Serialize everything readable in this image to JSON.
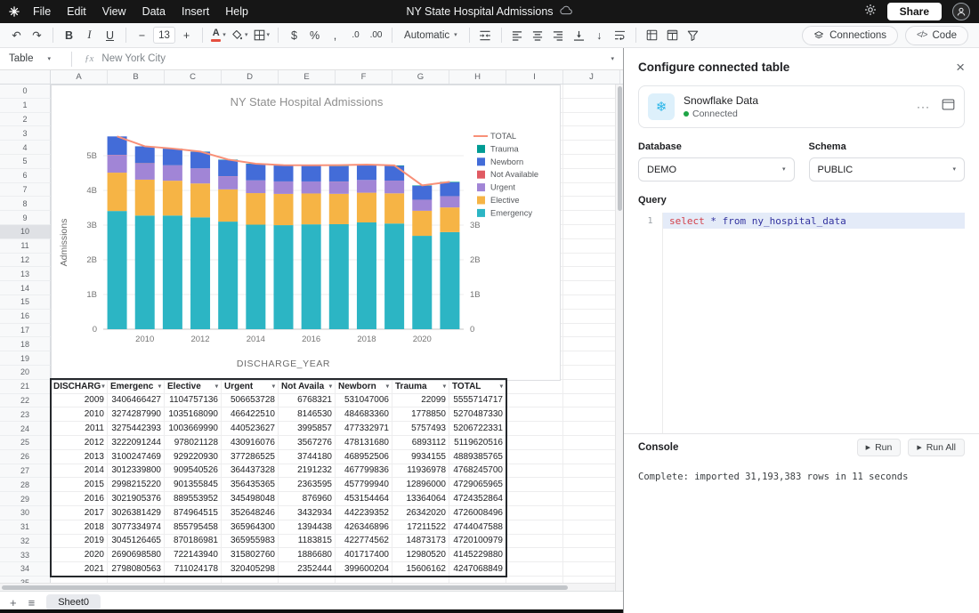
{
  "topbar": {
    "menus": [
      "File",
      "Edit",
      "View",
      "Data",
      "Insert",
      "Help"
    ],
    "title": "NY State Hospital Admissions",
    "share_label": "Share"
  },
  "toolbar": {
    "font_size": "13",
    "format_mode": "Automatic",
    "connections_label": "Connections",
    "code_label": "Code",
    "code_glyph": "</>"
  },
  "formula_bar": {
    "range_label": "Table",
    "value": "New York City"
  },
  "icons": {
    "undo": "↶",
    "redo": "↷",
    "bold": "B",
    "italic": "I",
    "underline": "U",
    "minus": "−",
    "plus": "+",
    "dollar": "$",
    "percent": "%",
    "comma": ",",
    "dec_dec": ".0",
    "dec_inc": ".00",
    "chevron": "▾",
    "fx": "ƒx",
    "close": "×",
    "dots": "···",
    "snowflake": "❄",
    "run": "▶",
    "add": "+",
    "list": "≡",
    "text_color": "A",
    "arrow_down": "↓"
  },
  "grid": {
    "columns": [
      "A",
      "B",
      "C",
      "D",
      "E",
      "F",
      "G",
      "H",
      "I",
      "J"
    ],
    "row_start": 0,
    "row_end": 35,
    "selected_row": 10
  },
  "table": {
    "origin": {
      "row": 21,
      "col": 0
    },
    "headers": [
      "DISCHARG",
      "Emergenc",
      "Elective",
      "Urgent",
      "Not Availa",
      "Newborn",
      "Trauma",
      "TOTAL"
    ],
    "rows": [
      [
        "2009",
        "3406466427",
        "1104757136",
        "506653728",
        "6768321",
        "531047006",
        "22099",
        "5555714717"
      ],
      [
        "2010",
        "3274287990",
        "1035168090",
        "466422510",
        "8146530",
        "484683360",
        "1778850",
        "5270487330"
      ],
      [
        "2011",
        "3275442393",
        "1003669990",
        "440523627",
        "3995857",
        "477332971",
        "5757493",
        "5206722331"
      ],
      [
        "2012",
        "3222091244",
        "978021128",
        "430916076",
        "3567276",
        "478131680",
        "6893112",
        "5119620516"
      ],
      [
        "2013",
        "3100247469",
        "929220930",
        "377286525",
        "3744180",
        "468952506",
        "9934155",
        "4889385765"
      ],
      [
        "2014",
        "3012339800",
        "909540526",
        "364437328",
        "2191232",
        "467799836",
        "11936978",
        "4768245700"
      ],
      [
        "2015",
        "2998215220",
        "901355845",
        "356435365",
        "2363595",
        "457799940",
        "12896000",
        "4729065965"
      ],
      [
        "2016",
        "3021905376",
        "889553952",
        "345498048",
        "876960",
        "453154464",
        "13364064",
        "4724352864"
      ],
      [
        "2017",
        "3026381429",
        "874964515",
        "352648246",
        "3432934",
        "442239352",
        "26342020",
        "4726008496"
      ],
      [
        "2018",
        "3077334974",
        "855795458",
        "365964300",
        "1394438",
        "426346896",
        "17211522",
        "4744047588"
      ],
      [
        "2019",
        "3045126465",
        "870186981",
        "365955983",
        "1183815",
        "422774562",
        "14873173",
        "4720100979"
      ],
      [
        "2020",
        "2690698580",
        "722143940",
        "315802760",
        "1886680",
        "401717400",
        "12980520",
        "4145229880"
      ],
      [
        "2021",
        "2798080563",
        "711024178",
        "320405298",
        "2352444",
        "399600204",
        "15606162",
        "4247068849"
      ]
    ]
  },
  "chart_data": {
    "type": "stacked_bar_with_line",
    "title": "NY State Hospital Admissions",
    "xlabel": "DISCHARGE_YEAR",
    "ylabel": "Admissions",
    "x": [
      2009,
      2010,
      2011,
      2012,
      2013,
      2014,
      2015,
      2016,
      2017,
      2018,
      2019,
      2020,
      2021
    ],
    "series": [
      {
        "name": "Emergency",
        "color": "#2cb5c4",
        "values": [
          3406466427,
          3274287990,
          3275442393,
          3222091244,
          3100247469,
          3012339800,
          2998215220,
          3021905376,
          3026381429,
          3077334974,
          3045126465,
          2690698580,
          2798080563
        ]
      },
      {
        "name": "Elective",
        "color": "#f6b445",
        "values": [
          1104757136,
          1035168090,
          1003669990,
          978021128,
          929220930,
          909540526,
          901355845,
          889553952,
          874964515,
          855795458,
          870186981,
          722143940,
          711024178
        ]
      },
      {
        "name": "Urgent",
        "color": "#a185d6",
        "values": [
          506653728,
          466422510,
          440523627,
          430916076,
          377286525,
          364437328,
          356435365,
          345498048,
          352648246,
          365964300,
          365955983,
          315802760,
          320405298
        ]
      },
      {
        "name": "Not Available",
        "color": "#e05a62",
        "values": [
          6768321,
          8146530,
          3995857,
          3567276,
          3744180,
          2191232,
          2363595,
          876960,
          3432934,
          1394438,
          1183815,
          1886680,
          2352444
        ]
      },
      {
        "name": "Newborn",
        "color": "#436cd8",
        "values": [
          531047006,
          484683360,
          477332971,
          478131680,
          468952506,
          467799836,
          457799940,
          453154464,
          442239352,
          426346896,
          422774562,
          401717400,
          399600204
        ]
      },
      {
        "name": "Trauma",
        "color": "#009b93",
        "values": [
          22099,
          1778850,
          5757493,
          6893112,
          9934155,
          11936978,
          12896000,
          13364064,
          26342020,
          17211522,
          14873173,
          12980520,
          15606162
        ]
      }
    ],
    "line": {
      "name": "TOTAL",
      "color": "#f89078",
      "values": [
        5555714717,
        5270487330,
        5206722331,
        5119620516,
        4889385765,
        4768245700,
        4729065965,
        4724352864,
        4726008496,
        4744047588,
        4720100979,
        4145229880,
        4247068849
      ]
    },
    "ylim": [
      0,
      5500000000
    ],
    "yticks_left": [
      {
        "v": 0,
        "label": "0"
      },
      {
        "v": 1000000000,
        "label": "1B"
      },
      {
        "v": 2000000000,
        "label": "2B"
      },
      {
        "v": 3000000000,
        "label": "3B"
      },
      {
        "v": 4000000000,
        "label": "4B"
      },
      {
        "v": 5000000000,
        "label": "5B"
      }
    ],
    "yticks_right": [
      {
        "v": 0,
        "label": "0"
      },
      {
        "v": 1000000000,
        "label": "1B"
      },
      {
        "v": 2000000000,
        "label": "2B"
      },
      {
        "v": 3000000000,
        "label": "3B"
      }
    ],
    "xticks": [
      2010,
      2012,
      2014,
      2016,
      2018,
      2020
    ],
    "legend": [
      {
        "label": "TOTAL",
        "color": "#f89078",
        "type": "line"
      },
      {
        "label": "Trauma",
        "color": "#009b93",
        "type": "square"
      },
      {
        "label": "Newborn",
        "color": "#436cd8",
        "type": "square"
      },
      {
        "label": "Not Available",
        "color": "#e05a62",
        "type": "square"
      },
      {
        "label": "Urgent",
        "color": "#a185d6",
        "type": "square"
      },
      {
        "label": "Elective",
        "color": "#f6b445",
        "type": "square"
      },
      {
        "label": "Emergency",
        "color": "#2cb5c4",
        "type": "square"
      }
    ],
    "legend_position": "right",
    "grid": true
  },
  "sheet_tabs": [
    "Sheet0"
  ],
  "panel": {
    "title": "Configure connected table",
    "source": {
      "name": "Snowflake Data",
      "status": "Connected",
      "status_color": "#1ea446",
      "brand_color": "#29b5e8"
    },
    "database": {
      "label": "Database",
      "value": "DEMO"
    },
    "schema": {
      "label": "Schema",
      "value": "PUBLIC"
    },
    "query": {
      "label": "Query",
      "line_no": "1",
      "keyword": "select",
      "rest": " * from ny_hospital_data"
    },
    "console": {
      "label": "Console",
      "run_label": "Run",
      "run_all_label": "Run All",
      "output": "Complete: imported 31,193,383 rows in 11 seconds"
    }
  }
}
